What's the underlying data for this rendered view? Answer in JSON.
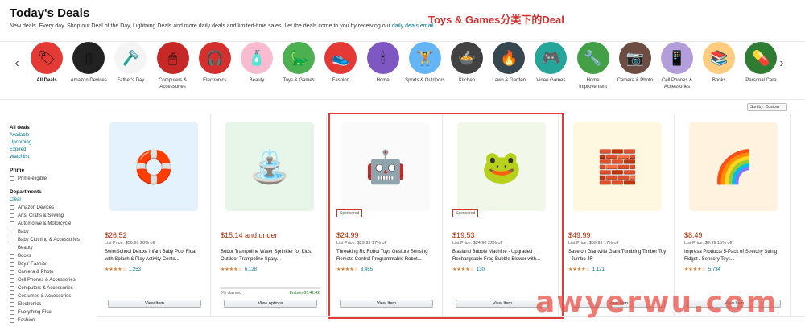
{
  "header": {
    "title": "Today's Deals",
    "subtitle": "New deals. Every day. Shop our Deal of the Day, Lightning Deals and more daily deals and limited-time sales. Let the deals come to you by receiving our",
    "subtitle_link": "daily deals email.",
    "annotation": "Toys & Games分类下的Deal"
  },
  "categories": [
    {
      "label": "All Deals",
      "icon": "shopping-tag-icon"
    },
    {
      "label": "Amazon Devices",
      "icon": "kindle-icon"
    },
    {
      "label": "Father's Day",
      "icon": "shaving-brush-icon"
    },
    {
      "label": "Computers & Accessories",
      "icon": "mouse-icon"
    },
    {
      "label": "Electronics",
      "icon": "headphones-icon"
    },
    {
      "label": "Beauty",
      "icon": "bottle-icon"
    },
    {
      "label": "Toys & Games",
      "icon": "dinosaur-icon"
    },
    {
      "label": "Fashion",
      "icon": "sneaker-icon"
    },
    {
      "label": "Home",
      "icon": "candle-icon"
    },
    {
      "label": "Sports & Outdoors",
      "icon": "dumbbell-icon"
    },
    {
      "label": "Kitchen",
      "icon": "pressure-cooker-icon"
    },
    {
      "label": "Lawn & Garden",
      "icon": "grill-icon"
    },
    {
      "label": "Video Games",
      "icon": "gamepad-icon"
    },
    {
      "label": "Home Improvement",
      "icon": "drill-icon"
    },
    {
      "label": "Camera & Photo",
      "icon": "camera-icon"
    },
    {
      "label": "Cell Phones & Accessories",
      "icon": "phone-icon"
    },
    {
      "label": "Books",
      "icon": "book-icon"
    },
    {
      "label": "Personal Care",
      "icon": "vitamins-icon"
    }
  ],
  "sort": {
    "label": "Sort by: Custom"
  },
  "sidebar": {
    "deal_links": [
      "All deals",
      "Available",
      "Upcoming",
      "Expired",
      "Watchlist"
    ],
    "prime_head": "Prime",
    "prime_option": "Prime eligible",
    "departments_head": "Departments",
    "clear": "Clear",
    "departments": [
      "Amazon Devices",
      "Arts, Crafts & Sewing",
      "Automotive & Motorcycle",
      "Baby",
      "Baby Clothing & Accessories",
      "Beauty",
      "Books",
      "Boys' Fashion",
      "Camera & Photo",
      "Cell Phones & Accessories",
      "Computers & Accessories",
      "Costumes & Accessories",
      "Electronics",
      "Everything Else",
      "Fashion"
    ]
  },
  "products": [
    {
      "image": "baby-boat-icon",
      "sponsored": "",
      "price": "$26.52",
      "list": "List Price: $56.99 28% off",
      "title": "SwimSchool Deluxe Infant Baby Pool Float with Splash & Play Activity Cente...",
      "stars": "★★★★☆",
      "count": "1,253",
      "claimed": "",
      "ends": "",
      "button": "View Item"
    },
    {
      "image": "trampoline-icon",
      "sponsored": "",
      "price": "$15.14 and under",
      "list": "",
      "title": "Bobor Trampoline Water Sprinkler for Kids, Outdoor Trampoline Spary...",
      "stars": "★★★★☆",
      "count": "6,128",
      "claimed": "0% claimed",
      "ends": "Ends in 05:42:42",
      "button": "View options"
    },
    {
      "image": "robot-icon",
      "sponsored": "Sponsored",
      "price": "$24.99",
      "list": "List Price: $29.99 17% off",
      "title": "Threeking Rc Robot Toys Gesture Sensing Remote Control Programmable Robot...",
      "stars": "★★★★☆",
      "count": "3,455",
      "claimed": "",
      "ends": "",
      "button": "View Item"
    },
    {
      "image": "frog-bubble-icon",
      "sponsored": "Sponsored",
      "price": "$19.53",
      "list": "List Price: $24.98 22% off",
      "title": "Blasland Bubble Machine - Upgraded Rechargeable Frog Bubble Blower with...",
      "stars": "★★★★☆",
      "count": "130",
      "claimed": "",
      "ends": "",
      "button": "View Item"
    },
    {
      "image": "tumbling-tower-icon",
      "sponsored": "",
      "price": "$49.99",
      "list": "List Price: $59.99 17% off",
      "title": "Save on Giantville Giant Tumbling Timber Toy - Jumbo JR",
      "stars": "★★★★☆",
      "count": "1,121",
      "claimed": "",
      "ends": "",
      "button": "View Item"
    },
    {
      "image": "fidget-noodle-icon",
      "sponsored": "",
      "price": "$8.49",
      "list": "List Price: $9.99 15% off",
      "title": "Impresa Products 5-Pack of Stretchy String Fidget / Sensory Toys...",
      "stars": "★★★★☆",
      "count": "5,734",
      "claimed": "",
      "ends": "",
      "button": "View Item"
    }
  ],
  "watermark": "awyerwu.com",
  "colors": {
    "price": "#b12704",
    "link": "#007185",
    "star": "#de7921",
    "annotation_red": "#d32f2f"
  }
}
